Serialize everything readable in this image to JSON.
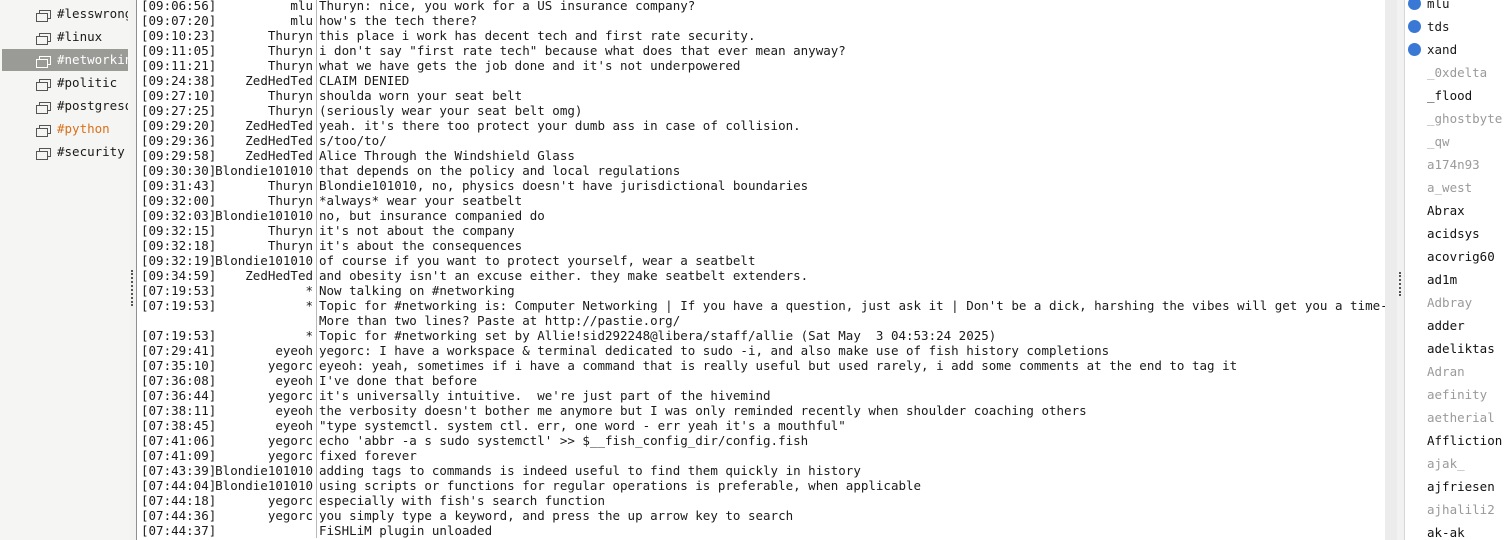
{
  "colors": {
    "selected_bg": "#9a9a97",
    "highlight": "#d9701a",
    "voice_dot": "#3a78d6",
    "away": "#9a9a9a"
  },
  "channels": [
    {
      "name": "#lesswrong",
      "state": "normal",
      "icon": "chat-bubble-icon"
    },
    {
      "name": "#linux",
      "state": "normal",
      "icon": "chat-bubble-icon"
    },
    {
      "name": "#networking",
      "state": "selected",
      "icon": "chat-bubble-icon"
    },
    {
      "name": "#politic",
      "state": "normal",
      "icon": "chat-bubble-icon"
    },
    {
      "name": "#postgresql",
      "state": "normal",
      "icon": "chat-bubble-icon"
    },
    {
      "name": "#python",
      "state": "highlight",
      "icon": "chat-bubble-icon"
    },
    {
      "name": "#security",
      "state": "normal",
      "icon": "chat-bubble-icon"
    }
  ],
  "messages": [
    {
      "time": "[09:06:56]",
      "nick": "mlu",
      "text": "Thuryn: nice, you work for a US insurance company?"
    },
    {
      "time": "[09:07:20]",
      "nick": "mlu",
      "text": "how's the tech there?"
    },
    {
      "time": "[09:10:23]",
      "nick": "Thuryn",
      "text": "this place i work has decent tech and first rate security."
    },
    {
      "time": "[09:11:05]",
      "nick": "Thuryn",
      "text": "i don't say \"first rate tech\" because what does that ever mean anyway?"
    },
    {
      "time": "[09:11:21]",
      "nick": "Thuryn",
      "text": "what we have gets the job done and it's not underpowered"
    },
    {
      "time": "[09:24:38]",
      "nick": "ZedHedTed",
      "text": "CLAIM DENIED"
    },
    {
      "time": "[09:27:10]",
      "nick": "Thuryn",
      "text": "shoulda worn your seat belt"
    },
    {
      "time": "[09:27:25]",
      "nick": "Thuryn",
      "text": "(seriously wear your seat belt omg)"
    },
    {
      "time": "[09:29:20]",
      "nick": "ZedHedTed",
      "text": "yeah. it's there too protect your dumb ass in case of collision."
    },
    {
      "time": "[09:29:36]",
      "nick": "ZedHedTed",
      "text": "s/too/to/"
    },
    {
      "time": "[09:29:58]",
      "nick": "ZedHedTed",
      "text": "Alice Through the Windshield Glass"
    },
    {
      "time": "[09:30:30]",
      "nick": "Blondie101010",
      "text": "that depends on the policy and local regulations"
    },
    {
      "time": "[09:31:43]",
      "nick": "Thuryn",
      "text": "Blondie101010, no, physics doesn't have jurisdictional boundaries"
    },
    {
      "time": "[09:32:00]",
      "nick": "Thuryn",
      "text": "*always* wear your seatbelt"
    },
    {
      "time": "[09:32:03]",
      "nick": "Blondie101010",
      "text": "no, but insurance companied do"
    },
    {
      "time": "[09:32:15]",
      "nick": "Thuryn",
      "text": "it's not about the company"
    },
    {
      "time": "[09:32:18]",
      "nick": "Thuryn",
      "text": "it's about the consequences"
    },
    {
      "time": "[09:32:19]",
      "nick": "Blondie101010",
      "text": "of course if you want to protect yourself, wear a seatbelt"
    },
    {
      "time": "[09:34:59]",
      "nick": "ZedHedTed",
      "text": "and obesity isn't an excuse either. they make seatbelt extenders."
    },
    {
      "time": "[07:19:53]",
      "nick": "*",
      "text": "Now talking on #networking"
    },
    {
      "time": "[07:19:53]",
      "nick": "*",
      "text": "Topic for #networking is: Computer Networking | If you have a question, just ask it | Don't be a dick, harshing the vibes will get you a time-out |"
    },
    {
      "time": "",
      "nick": "",
      "text": "More than two lines? Paste at http://pastie.org/"
    },
    {
      "time": "[07:19:53]",
      "nick": "*",
      "text": "Topic for #networking set by Allie!sid292248@libera/staff/allie (Sat May  3 04:53:24 2025)"
    },
    {
      "time": "[07:29:41]",
      "nick": "eyeoh",
      "text": "yegorc: I have a workspace & terminal dedicated to sudo -i, and also make use of fish history completions"
    },
    {
      "time": "[07:35:10]",
      "nick": "yegorc",
      "text": "eyeoh: yeah, sometimes if i have a command that is really useful but used rarely, i add some comments at the end to tag it"
    },
    {
      "time": "[07:36:08]",
      "nick": "eyeoh",
      "text": "I've done that before"
    },
    {
      "time": "[07:36:44]",
      "nick": "yegorc",
      "text": "it's universally intuitive.  we're just part of the hivemind"
    },
    {
      "time": "[07:38:11]",
      "nick": "eyeoh",
      "text": "the verbosity doesn't bother me anymore but I was only reminded recently when shoulder coaching others"
    },
    {
      "time": "[07:38:45]",
      "nick": "eyeoh",
      "text": "\"type systemctl. system ctl. err, one word - err yeah it's a mouthful\""
    },
    {
      "time": "[07:41:06]",
      "nick": "yegorc",
      "text": "echo 'abbr -a s sudo systemctl' >> $__fish_config_dir/config.fish"
    },
    {
      "time": "[07:41:09]",
      "nick": "yegorc",
      "text": "fixed forever"
    },
    {
      "time": "[07:43:39]",
      "nick": "Blondie101010",
      "text": "adding tags to commands is indeed useful to find them quickly in history"
    },
    {
      "time": "[07:44:04]",
      "nick": "Blondie101010",
      "text": "using scripts or functions for regular operations is preferable, when applicable"
    },
    {
      "time": "[07:44:18]",
      "nick": "yegorc",
      "text": "especially with fish's search function"
    },
    {
      "time": "[07:44:36]",
      "nick": "yegorc",
      "text": "you simply type a keyword, and press the up arrow key to search"
    },
    {
      "time": "[07:44:37]",
      "nick": "",
      "text": "FiSHLiM plugin unloaded"
    }
  ],
  "users": [
    {
      "name": "mlu",
      "status": "voice"
    },
    {
      "name": "tds",
      "status": "voice"
    },
    {
      "name": "xand",
      "status": "voice"
    },
    {
      "name": "_0xdelta",
      "status": "away"
    },
    {
      "name": "_flood",
      "status": "active"
    },
    {
      "name": "_ghostbyte",
      "status": "away"
    },
    {
      "name": "_qw",
      "status": "away"
    },
    {
      "name": "a174n93",
      "status": "away"
    },
    {
      "name": "a_west",
      "status": "away"
    },
    {
      "name": "Abrax",
      "status": "active"
    },
    {
      "name": "acidsys",
      "status": "active"
    },
    {
      "name": "acovrig60",
      "status": "active"
    },
    {
      "name": "ad1m",
      "status": "active"
    },
    {
      "name": "Adbray",
      "status": "away"
    },
    {
      "name": "adder",
      "status": "active"
    },
    {
      "name": "adeliktas",
      "status": "active"
    },
    {
      "name": "Adran",
      "status": "away"
    },
    {
      "name": "aefinity",
      "status": "away"
    },
    {
      "name": "aetherial",
      "status": "away"
    },
    {
      "name": "Affliction",
      "status": "active"
    },
    {
      "name": "ajak_",
      "status": "away"
    },
    {
      "name": "ajfriesen",
      "status": "active"
    },
    {
      "name": "ajhalili2",
      "status": "away"
    },
    {
      "name": "ak-ak",
      "status": "active"
    }
  ]
}
